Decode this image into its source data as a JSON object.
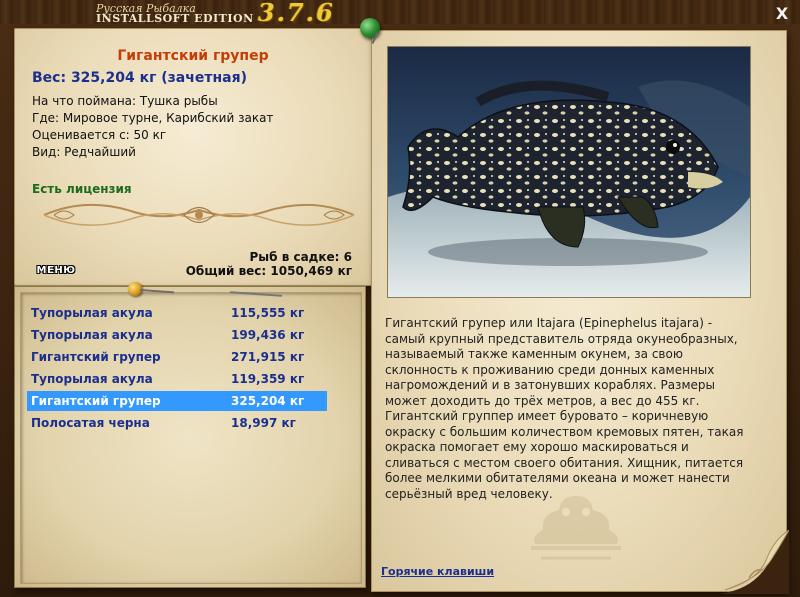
{
  "title": {
    "ru": "Русская Рыбалка",
    "en": "INSTALLSOFT EDITION",
    "version": "3.7.6",
    "close": "X"
  },
  "fish": {
    "name": "Гигантский групер",
    "weight": "Вес: 325,204 кг (зачетная)",
    "bait": "На что поймана: Тушка рыбы",
    "place": "Где: Мировое турне, Карибский закат",
    "value": "Оценивается с: 50 кг",
    "rarity": "Вид: Редчайший",
    "license": "Есть лицензия"
  },
  "summary": {
    "cage": "Рыб в садке: 6",
    "total": "Общий вес: 1050,469 кг"
  },
  "menu": {
    "label": "МЕНЮ"
  },
  "catch_list": [
    {
      "name": "Тупорылая акула",
      "weight": "115,555 кг",
      "selected": false
    },
    {
      "name": "Тупорылая акула",
      "weight": "199,436 кг",
      "selected": false
    },
    {
      "name": "Гигантский групер",
      "weight": "271,915 кг",
      "selected": false
    },
    {
      "name": "Тупорылая акула",
      "weight": "119,359 кг",
      "selected": false
    },
    {
      "name": "Гигантский групер",
      "weight": "325,204 кг",
      "selected": true
    },
    {
      "name": "Полосатая черна",
      "weight": "18,997 кг",
      "selected": false
    }
  ],
  "description": "Гигантский групер или Itajara (Epinephelus itajara) - самый крупный представитель отряда окунеобразных, называемый также каменным окунем, за свою склонность к проживанию среди донных каменных нагромождений и в затонувших кораблях. Размеры может доходить до трёх метров, а вес до 455 кг. Гигантский группер имеет буровато – коричневую окраску с большим количеством кремовых пятен, такая окраска помогает ему хорошо маскироваться и сливаться с местом своего обитания. Хищник, питается более мелкими обитателями океана и может нанести серьёзный вред человеку.",
  "hotkeys": "Горячие клавиши",
  "colors": {
    "accent_title": "#c43d07",
    "link_blue": "#1b2f8e",
    "license_green": "#1e6b1f",
    "selection": "#3399ff"
  },
  "icons": [
    "green-pin-icon",
    "gold-pin-icon",
    "close-icon",
    "photo-fish",
    "stamp-logo-icon",
    "page-curl-icon",
    "ornament-divider"
  ]
}
